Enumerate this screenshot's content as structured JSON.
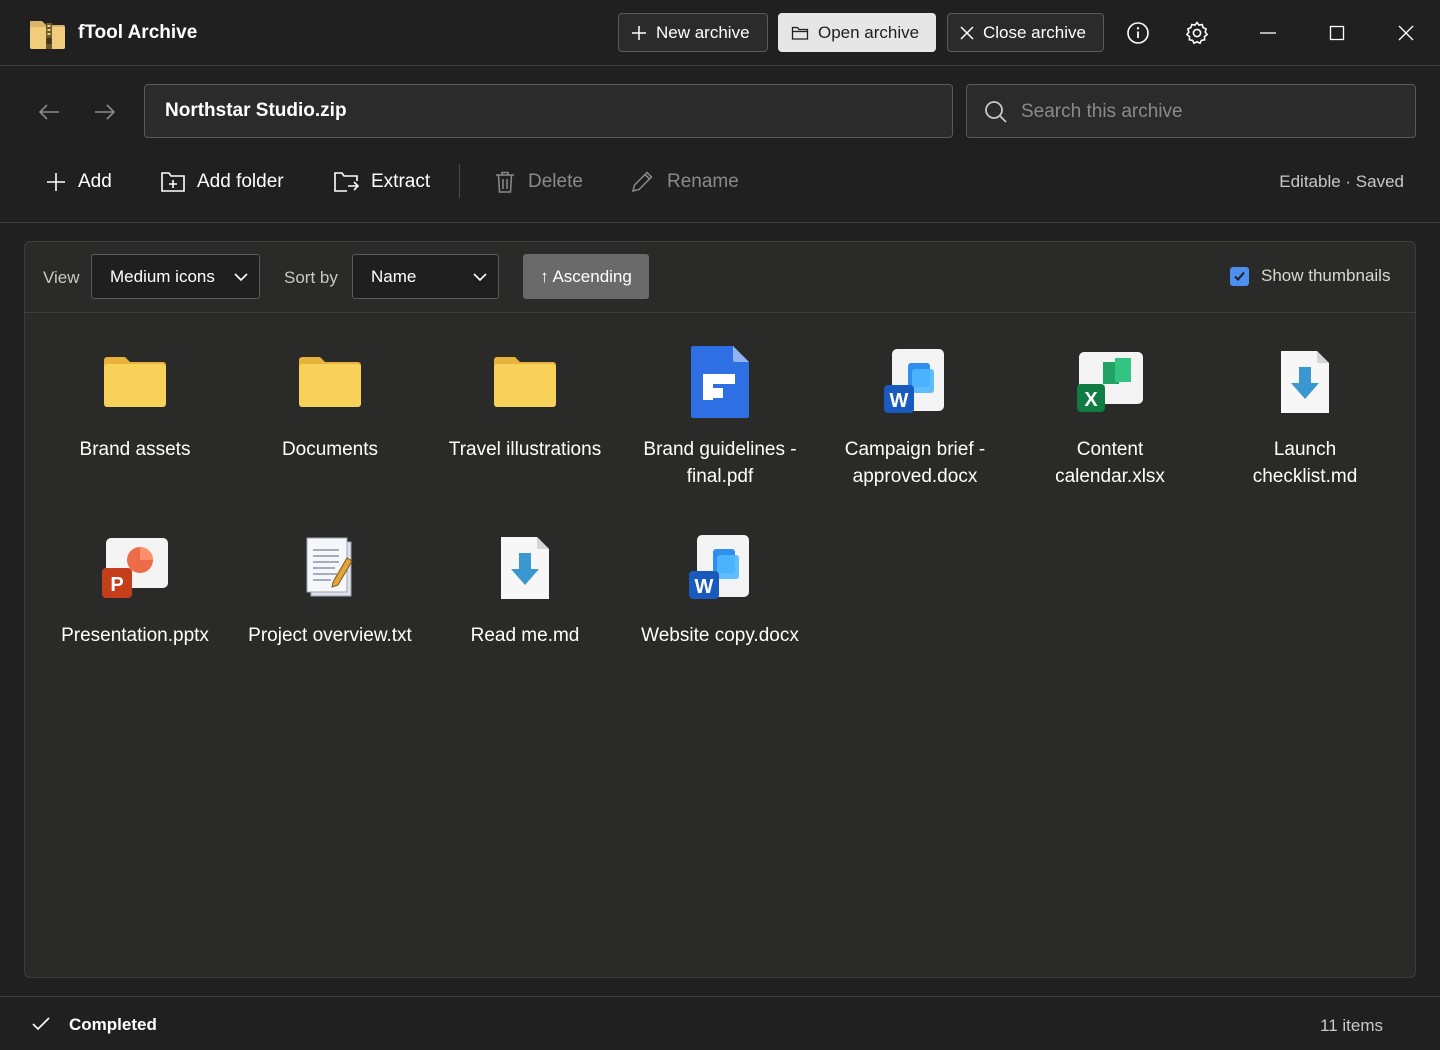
{
  "app": {
    "title": "fTool Archive",
    "buttons": {
      "new_archive": "New archive",
      "open_archive": "Open archive",
      "close_archive": "Close archive"
    }
  },
  "address": {
    "path": "Northstar Studio.zip",
    "search_placeholder": "Search this archive"
  },
  "commands": {
    "add": "Add",
    "add_folder": "Add folder",
    "extract": "Extract",
    "delete": "Delete",
    "rename": "Rename",
    "status": "Editable · Saved"
  },
  "view_bar": {
    "view_label": "View",
    "view_value": "Medium icons",
    "sort_label": "Sort by",
    "sort_value": "Name",
    "sort_direction": "↑ Ascending",
    "show_thumbnails_label": "Show thumbnails",
    "show_thumbnails_checked": true
  },
  "items": [
    {
      "name": "Brand assets",
      "icon": "folder-icon"
    },
    {
      "name": "Documents",
      "icon": "folder-icon"
    },
    {
      "name": "Travel illustrations",
      "icon": "folder-icon"
    },
    {
      "name": "Brand guidelines - final.pdf",
      "icon": "pdf-file-icon"
    },
    {
      "name": "Campaign brief - approved.docx",
      "icon": "word-file-icon"
    },
    {
      "name": "Content calendar.xlsx",
      "icon": "excel-file-icon"
    },
    {
      "name": "Launch checklist.md",
      "icon": "markdown-file-icon"
    },
    {
      "name": "Presentation.pptx",
      "icon": "powerpoint-file-icon"
    },
    {
      "name": "Project overview.txt",
      "icon": "text-file-icon"
    },
    {
      "name": "Read me.md",
      "icon": "markdown-file-icon"
    },
    {
      "name": "Website copy.docx",
      "icon": "word-file-icon"
    }
  ],
  "status_bar": {
    "text": "Completed",
    "count": "11 items"
  },
  "colors": {
    "background": "#202020",
    "panel": "#2a2a29",
    "folder": "#f7d15a",
    "accent_blue": "#4c8ff0",
    "word": "#185abd",
    "excel": "#107c41",
    "powerpoint": "#c43e1c"
  }
}
